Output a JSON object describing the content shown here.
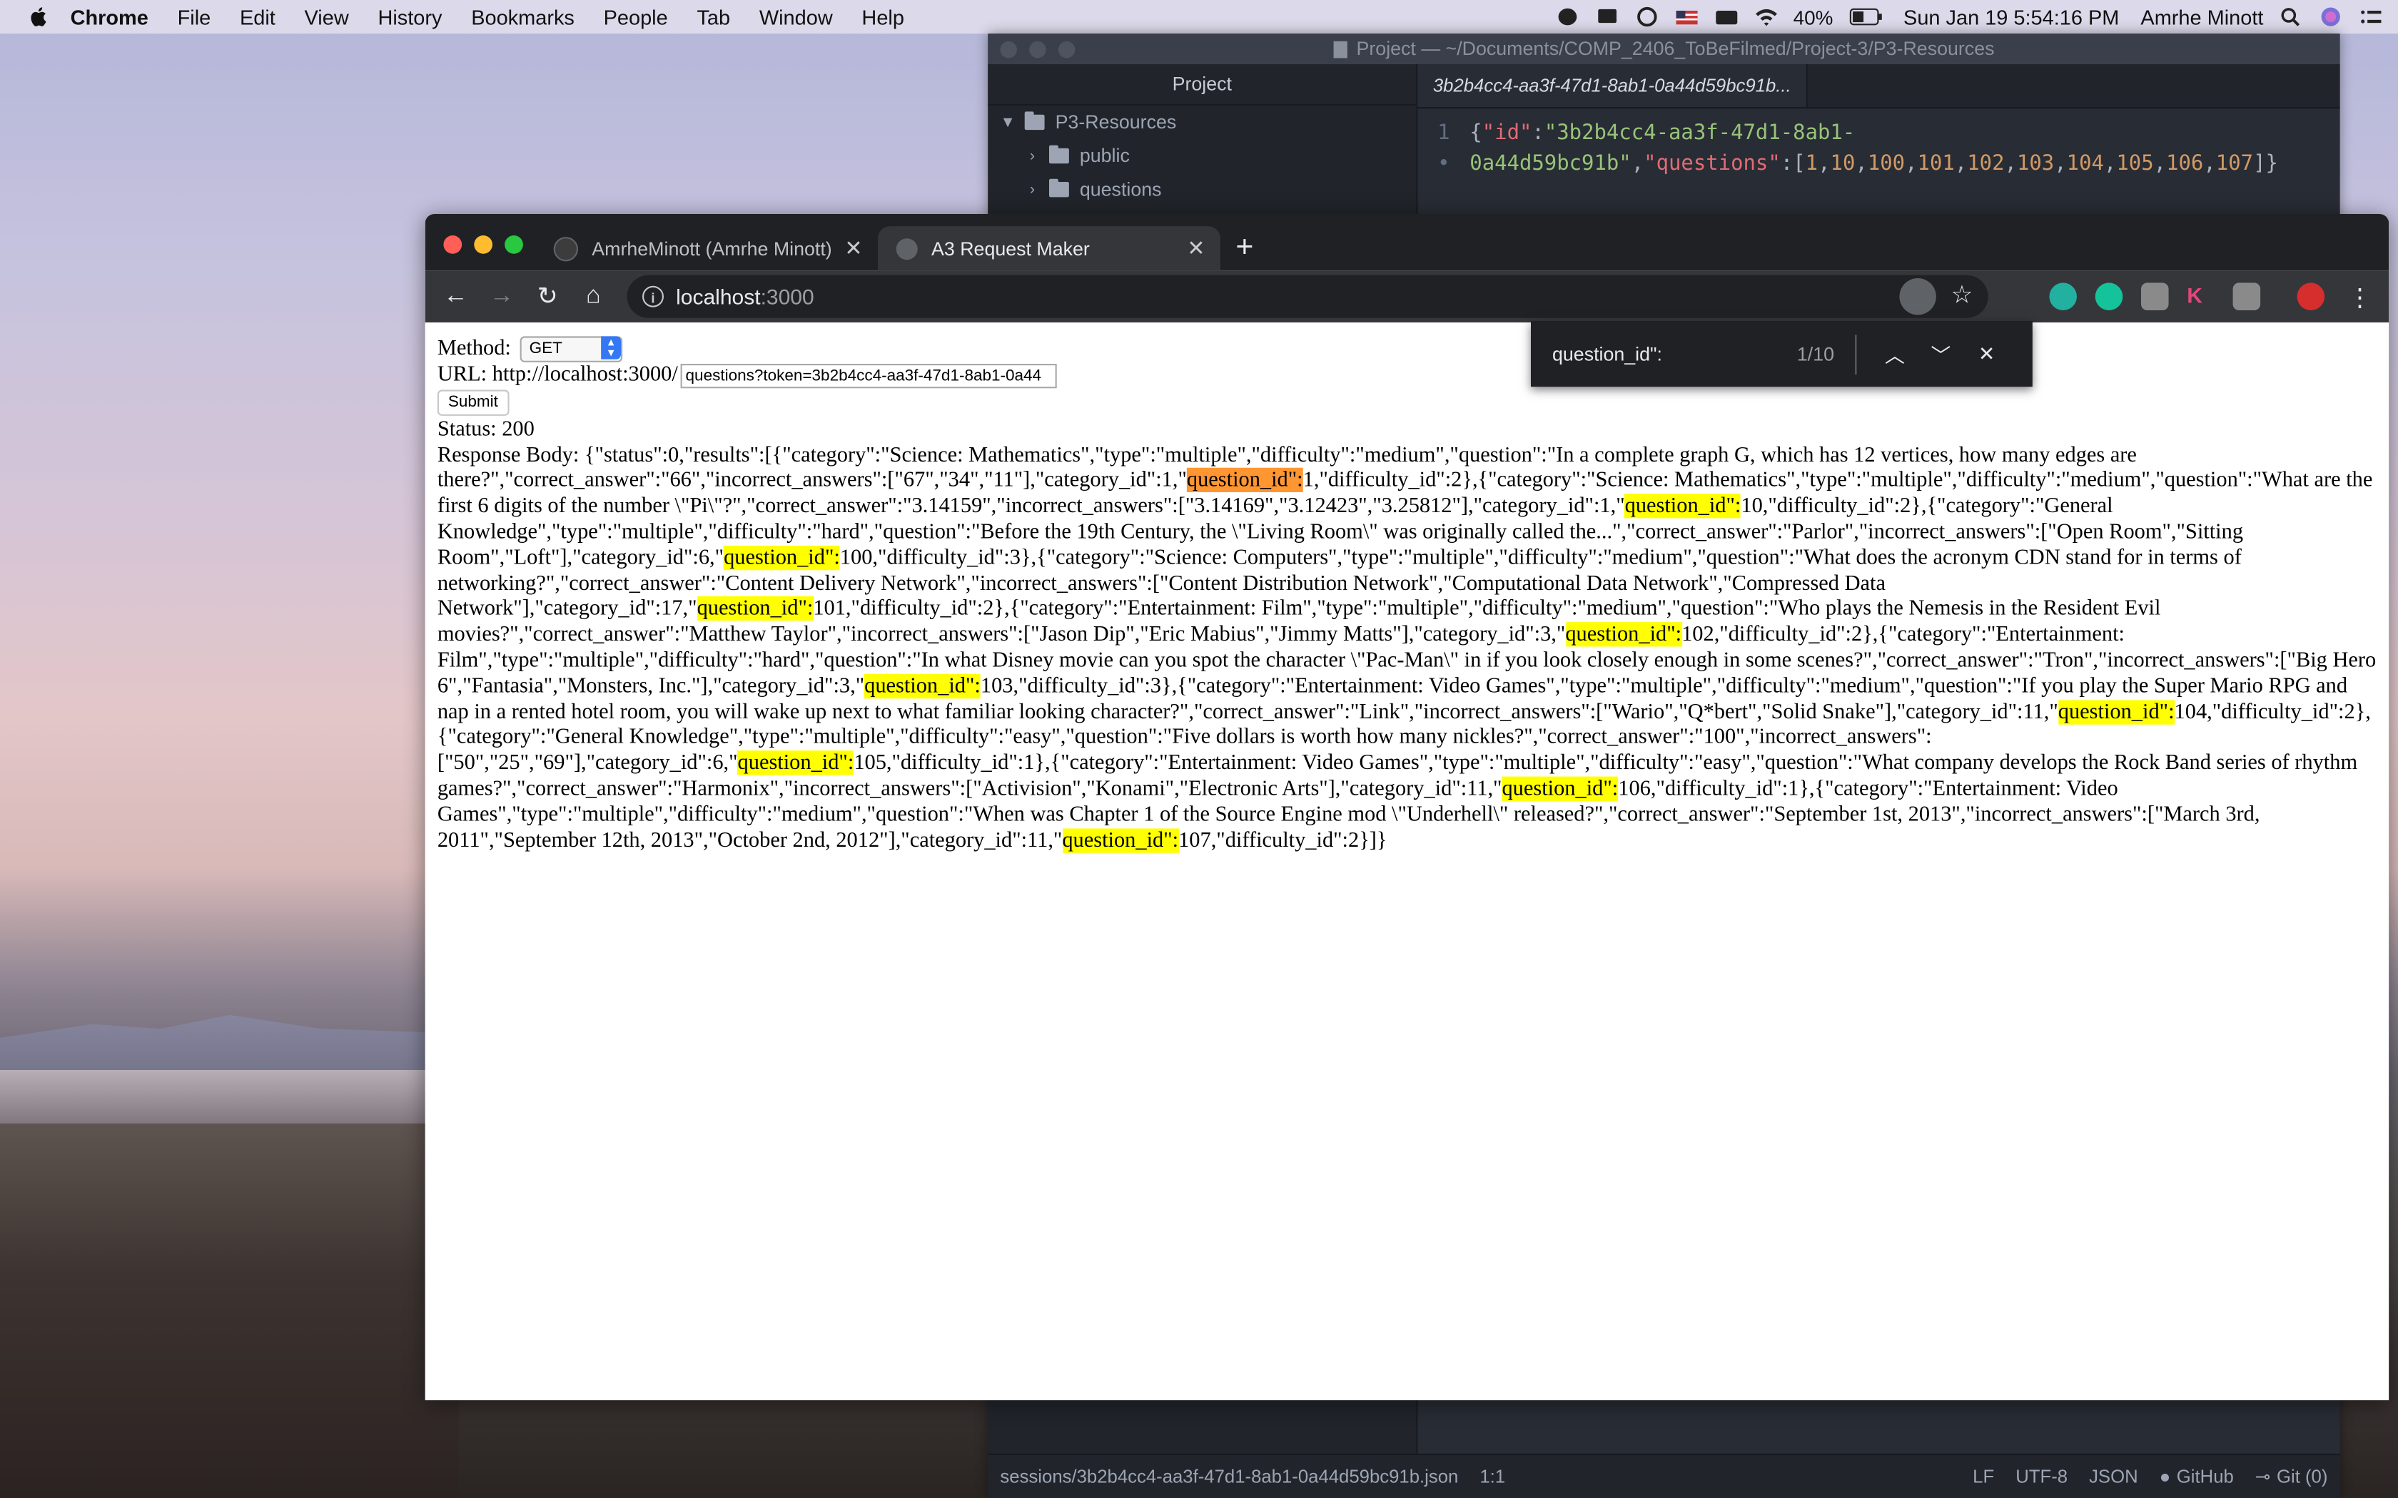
{
  "menubar": {
    "items": [
      "Chrome",
      "File",
      "Edit",
      "View",
      "History",
      "Bookmarks",
      "People",
      "Tab",
      "Window",
      "Help"
    ],
    "battery": "40%",
    "datetime": "Sun Jan 19  5:54:16 PM",
    "user": "Amrhe Minott"
  },
  "atom": {
    "title": "Project — ~/Documents/COMP_2406_ToBeFilmed/Project-3/P3-Resources",
    "tree_header": "Project",
    "root_folder": "P3-Resources",
    "folders": [
      "public",
      "questions"
    ],
    "tab_title": "3b2b4cc4-aa3f-47d1-8ab1-0a44d59bc91b...",
    "line_numbers": [
      "1",
      "•"
    ],
    "code": {
      "brace_open": "{",
      "key_id": "\"id\"",
      "colon": ":",
      "id_part1": "\"3b2b4cc4-aa3f-47d1-8ab1-",
      "id_part2": "0a44d59bc91b\"",
      "comma": ",",
      "key_questions": "\"questions\"",
      "arr_open": "[",
      "numbers": [
        "1",
        "10",
        "100",
        "101",
        "102",
        "103",
        "104",
        "105",
        "106",
        "107"
      ],
      "arr_close": "]",
      "brace_close": "}"
    },
    "status": {
      "path": "sessions/3b2b4cc4-aa3f-47d1-8ab1-0a44d59bc91b.json",
      "cursor": "1:1",
      "eol": "LF",
      "encoding": "UTF-8",
      "grammar": "JSON",
      "github": "GitHub",
      "git": "Git (0)"
    }
  },
  "chrome": {
    "tabs": [
      {
        "title": "AmrheMinott (Amrhe Minott)"
      },
      {
        "title": "A3 Request Maker"
      }
    ],
    "new_tab": "+",
    "url_host": "localhost",
    "url_port": ":3000",
    "find": {
      "query": "question_id\":",
      "count": "1/10"
    }
  },
  "page": {
    "method_label": "Method:",
    "method_value": "GET",
    "url_label": "URL: http://localhost:3000/",
    "url_input": "questions?token=3b2b4cc4-aa3f-47d1-8ab1-0a44",
    "submit": "Submit",
    "status": "Status: 200",
    "body_prefix": "Response Body: ",
    "match": "question_id\":",
    "body_segments": [
      "{\"status\":0,\"results\":[{\"category\":\"Science: Mathematics\",\"type\":\"multiple\",\"difficulty\":\"medium\",\"question\":\"In a complete graph G, which has 12 vertices, how many edges are there?\",\"correct_answer\":\"66\",\"incorrect_answers\":[\"67\",\"34\",\"11\"],\"category_id\":1,\"",
      "1,\"difficulty_id\":2},{\"category\":\"Science: Mathematics\",\"type\":\"multiple\",\"difficulty\":\"medium\",\"question\":\"What are the first 6 digits of the number \\\"Pi\\\"?\",\"correct_answer\":\"3.14159\",\"incorrect_answers\":[\"3.14169\",\"3.12423\",\"3.25812\"],\"category_id\":1,\"",
      "10,\"difficulty_id\":2},{\"category\":\"General Knowledge\",\"type\":\"multiple\",\"difficulty\":\"hard\",\"question\":\"Before the 19th Century, the \\\"Living Room\\\" was originally called the...\",\"correct_answer\":\"Parlor\",\"incorrect_answers\":[\"Open Room\",\"Sitting Room\",\"Loft\"],\"category_id\":6,\"",
      "100,\"difficulty_id\":3},{\"category\":\"Science: Computers\",\"type\":\"multiple\",\"difficulty\":\"medium\",\"question\":\"What does the acronym CDN stand for in terms of networking?\",\"correct_answer\":\"Content Delivery Network\",\"incorrect_answers\":[\"Content Distribution Network\",\"Computational Data Network\",\"Compressed Data Network\"],\"category_id\":17,\"",
      "101,\"difficulty_id\":2},{\"category\":\"Entertainment: Film\",\"type\":\"multiple\",\"difficulty\":\"medium\",\"question\":\"Who plays the Nemesis in the Resident Evil movies?\",\"correct_answer\":\"Matthew Taylor\",\"incorrect_answers\":[\"Jason Dip\",\"Eric Mabius\",\"Jimmy Matts\"],\"category_id\":3,\"",
      "102,\"difficulty_id\":2},{\"category\":\"Entertainment: Film\",\"type\":\"multiple\",\"difficulty\":\"hard\",\"question\":\"In what Disney movie can you spot the character \\\"Pac-Man\\\" in if you look closely enough in some scenes?\",\"correct_answer\":\"Tron\",\"incorrect_answers\":[\"Big Hero 6\",\"Fantasia\",\"Monsters, Inc.\"],\"category_id\":3,\"",
      "103,\"difficulty_id\":3},{\"category\":\"Entertainment: Video Games\",\"type\":\"multiple\",\"difficulty\":\"medium\",\"question\":\"If you play the Super Mario RPG and nap in a rented hotel room, you will wake up next to what familiar looking character?\",\"correct_answer\":\"Link\",\"incorrect_answers\":[\"Wario\",\"Q*bert\",\"Solid Snake\"],\"category_id\":11,\"",
      "104,\"difficulty_id\":2},{\"category\":\"General Knowledge\",\"type\":\"multiple\",\"difficulty\":\"easy\",\"question\":\"Five dollars is worth how many nickles?\",\"correct_answer\":\"100\",\"incorrect_answers\":[\"50\",\"25\",\"69\"],\"category_id\":6,\"",
      "105,\"difficulty_id\":1},{\"category\":\"Entertainment: Video Games\",\"type\":\"multiple\",\"difficulty\":\"easy\",\"question\":\"What company develops the Rock Band series of rhythm games?\",\"correct_answer\":\"Harmonix\",\"incorrect_answers\":[\"Activision\",\"Konami\",\"Electronic Arts\"],\"category_id\":11,\"",
      "106,\"difficulty_id\":1},{\"category\":\"Entertainment: Video Games\",\"type\":\"multiple\",\"difficulty\":\"medium\",\"question\":\"When was Chapter 1 of the Source Engine mod \\\"Underhell\\\" released?\",\"correct_answer\":\"September 1st, 2013\",\"incorrect_answers\":[\"March 3rd, 2011\",\"September 12th, 2013\",\"October 2nd, 2012\"],\"category_id\":11,\"",
      "107,\"difficulty_id\":2}]}"
    ]
  }
}
